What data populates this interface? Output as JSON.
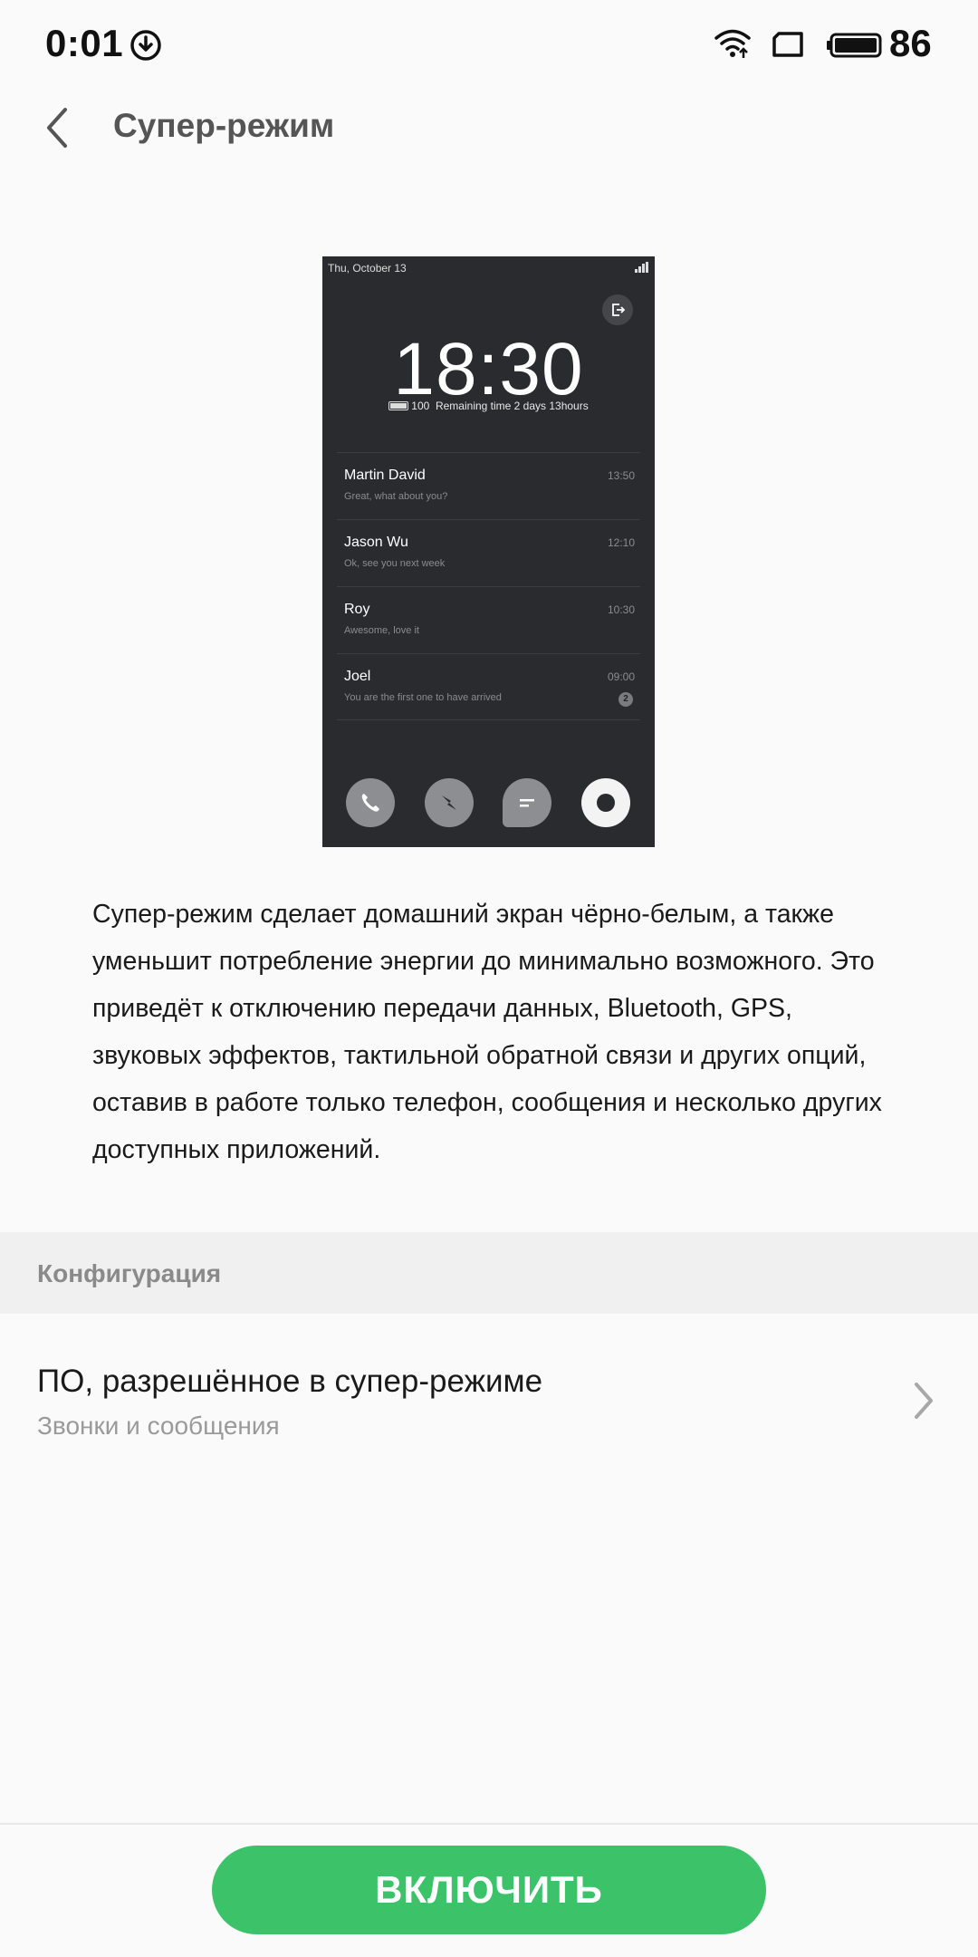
{
  "status_bar": {
    "time": "0:01",
    "battery_level": "86",
    "icons": [
      "download-icon",
      "wifi-icon",
      "screen-icon",
      "battery-icon"
    ]
  },
  "header": {
    "title": "Супер-режим",
    "back_icon": "chevron-left-icon"
  },
  "preview": {
    "date": "Thu, October 13",
    "clock": "18:30",
    "battery": "100",
    "remaining": "Remaining time 2 days 13hours",
    "messages": [
      {
        "name": "Martin David",
        "text": "Great, what about you?",
        "time": "13:50"
      },
      {
        "name": "Jason Wu",
        "text": "Ok, see you next week",
        "time": "12:10"
      },
      {
        "name": "Roy",
        "text": "Awesome, love it",
        "time": "10:30"
      },
      {
        "name": "Joel",
        "text": "You are the first one to have arrived",
        "time": "09:00",
        "badge": "2"
      }
    ],
    "dock_icons": [
      "phone-icon",
      "compass-icon",
      "message-icon",
      "camera-icon"
    ]
  },
  "description": "Супер-режим сделает домашний экран чёрно-белым, а также уменьшит потребление энергии до минимально возможного. Это приведёт к отключению передачи данных, Bluetooth, GPS, звуковых эффектов, тактильной обратной связи и других опций, оставив в работе только телефон, сообщения и несколько других доступных приложений.",
  "section": {
    "label": "Конфигурация"
  },
  "setting_row": {
    "title": "ПО, разрешённое в супер-режиме",
    "subtitle": "Звонки и сообщения"
  },
  "enable_button": {
    "label": "ВКЛЮЧИТЬ",
    "color": "#3cc36a"
  }
}
